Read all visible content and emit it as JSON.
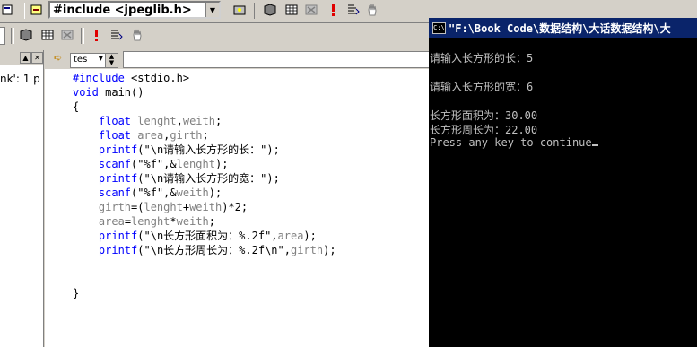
{
  "toolbar_top": {
    "include_selector": {
      "value": "#include <jpeglib.h>"
    },
    "icons": [
      "class-view-icon",
      "filter-icon",
      "wizard-icon",
      "compile-icon",
      "build-icon",
      "stop-build-icon",
      "execute-icon",
      "breakpoint-icon",
      "hand-icon"
    ]
  },
  "toolbar_second": {
    "icons": [
      "compile-icon",
      "build-icon",
      "stop-build-icon",
      "execute-icon",
      "go-icon",
      "hand-icon"
    ]
  },
  "left_panel": {
    "text": "nk': 1 p"
  },
  "wizard_bar": {
    "class_combo": "tes"
  },
  "editor": {
    "lines": [
      {
        "parts": [
          {
            "t": "#include",
            "c": "kw"
          },
          {
            "t": " <stdio.h>",
            "c": ""
          }
        ]
      },
      {
        "parts": [
          {
            "t": "void",
            "c": "kw"
          },
          {
            "t": " main()",
            "c": ""
          }
        ]
      },
      {
        "parts": [
          {
            "t": "{",
            "c": ""
          }
        ]
      },
      {
        "parts": [
          {
            "t": "    ",
            "c": ""
          },
          {
            "t": "float",
            "c": "kw"
          },
          {
            "t": " ",
            "c": ""
          },
          {
            "t": "lenght",
            "c": "vr"
          },
          {
            "t": ",",
            "c": ""
          },
          {
            "t": "weith",
            "c": "vr"
          },
          {
            "t": ";",
            "c": ""
          }
        ]
      },
      {
        "parts": [
          {
            "t": "    ",
            "c": ""
          },
          {
            "t": "float",
            "c": "kw"
          },
          {
            "t": " ",
            "c": ""
          },
          {
            "t": "area",
            "c": "vr"
          },
          {
            "t": ",",
            "c": ""
          },
          {
            "t": "girth",
            "c": "vr"
          },
          {
            "t": ";",
            "c": ""
          }
        ]
      },
      {
        "parts": [
          {
            "t": "    ",
            "c": ""
          },
          {
            "t": "printf",
            "c": "kw"
          },
          {
            "t": "(\"\\n请输入长方形的长：\");",
            "c": ""
          }
        ]
      },
      {
        "parts": [
          {
            "t": "    ",
            "c": ""
          },
          {
            "t": "scanf",
            "c": "kw"
          },
          {
            "t": "(\"%f\",&",
            "c": ""
          },
          {
            "t": "lenght",
            "c": "vr"
          },
          {
            "t": ");",
            "c": ""
          }
        ]
      },
      {
        "parts": [
          {
            "t": "    ",
            "c": ""
          },
          {
            "t": "printf",
            "c": "kw"
          },
          {
            "t": "(\"\\n请输入长方形的宽：\");",
            "c": ""
          }
        ]
      },
      {
        "parts": [
          {
            "t": "    ",
            "c": ""
          },
          {
            "t": "scanf",
            "c": "kw"
          },
          {
            "t": "(\"%f\",&",
            "c": ""
          },
          {
            "t": "weith",
            "c": "vr"
          },
          {
            "t": ");",
            "c": ""
          }
        ]
      },
      {
        "parts": [
          {
            "t": "    ",
            "c": ""
          },
          {
            "t": "girth",
            "c": "vr"
          },
          {
            "t": "=(",
            "c": ""
          },
          {
            "t": "lenght",
            "c": "vr"
          },
          {
            "t": "+",
            "c": ""
          },
          {
            "t": "weith",
            "c": "vr"
          },
          {
            "t": ")*2;",
            "c": ""
          }
        ]
      },
      {
        "parts": [
          {
            "t": "    ",
            "c": ""
          },
          {
            "t": "area",
            "c": "vr"
          },
          {
            "t": "=",
            "c": ""
          },
          {
            "t": "lenght",
            "c": "vr"
          },
          {
            "t": "*",
            "c": ""
          },
          {
            "t": "weith",
            "c": "vr"
          },
          {
            "t": ";",
            "c": ""
          }
        ]
      },
      {
        "parts": [
          {
            "t": "    ",
            "c": ""
          },
          {
            "t": "printf",
            "c": "kw"
          },
          {
            "t": "(\"\\n长方形面积为：%.2f\",",
            "c": ""
          },
          {
            "t": "area",
            "c": "vr"
          },
          {
            "t": ");",
            "c": ""
          }
        ]
      },
      {
        "parts": [
          {
            "t": "    ",
            "c": ""
          },
          {
            "t": "printf",
            "c": "kw"
          },
          {
            "t": "(\"\\n长方形周长为：%.2f\\n\",",
            "c": ""
          },
          {
            "t": "girth",
            "c": "vr"
          },
          {
            "t": ");",
            "c": ""
          }
        ]
      },
      {
        "parts": [
          {
            "t": "",
            "c": ""
          }
        ]
      },
      {
        "parts": [
          {
            "t": "",
            "c": ""
          }
        ]
      },
      {
        "parts": [
          {
            "t": "}",
            "c": ""
          }
        ]
      }
    ],
    "colors": {
      "keyword": "#0000ff",
      "variable": "#808080",
      "text": "#000000"
    }
  },
  "console": {
    "title": "\"F:\\Book Code\\数据结构\\大话数据结构\\大",
    "lines": [
      "",
      "请输入长方形的长：5",
      "",
      "请输入长方形的宽：6",
      "",
      "长方形面积为：30.00",
      "长方形周长为：22.00",
      "Press any key to continue"
    ],
    "colors": {
      "title_bar": "#0a246a",
      "background": "#000000",
      "text": "#c0c0c0"
    }
  }
}
